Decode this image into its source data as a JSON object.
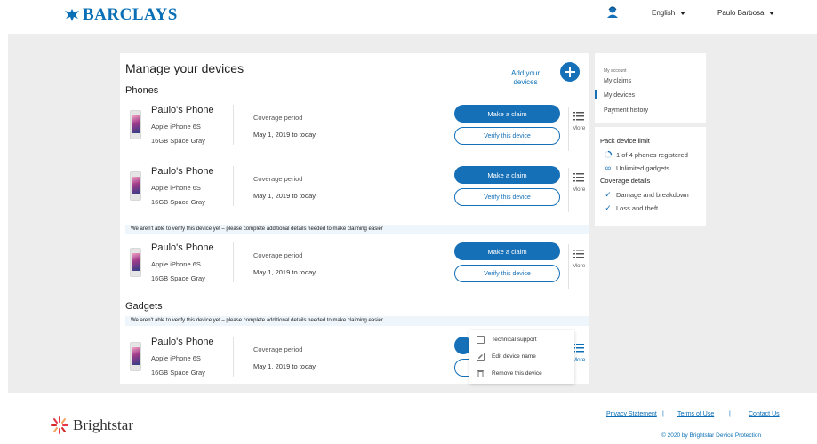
{
  "header": {
    "brand": "BARCLAYS",
    "language": "English",
    "user_name": "Paulo Barbosa"
  },
  "main": {
    "title": "Manage your devices",
    "add_label": "Add your devices",
    "phones_heading": "Phones",
    "gadgets_heading": "Gadgets",
    "warning": "We aren't able to verify this device yet – please complete additional details needed to make claiming easier",
    "devices": [
      {
        "name": "Paulo's Phone",
        "model": "Apple iPhone 6S",
        "spec": "16GB Space Gray",
        "coverage_label": "Coverage period",
        "coverage_dates": "May 1, 2019 to today",
        "claim_label": "Make a claim",
        "verify_label": "Verify this device",
        "more_label": "More"
      },
      {
        "name": "Paulo's Phone",
        "model": "Apple iPhone 6S",
        "spec": "16GB Space Gray",
        "coverage_label": "Coverage period",
        "coverage_dates": "May 1, 2019 to today",
        "claim_label": "Make a claim",
        "verify_label": "Verify this device",
        "more_label": "More"
      },
      {
        "name": "Paulo's Phone",
        "model": "Apple iPhone 6S",
        "spec": "16GB Space Gray",
        "coverage_label": "Coverage period",
        "coverage_dates": "May 1, 2019 to today",
        "claim_label": "Make a claim",
        "verify_label": "Verify this device",
        "more_label": "More"
      },
      {
        "name": "Paulo's Phone",
        "model": "Apple iPhone 6S",
        "spec": "16GB Space Gray",
        "coverage_label": "Coverage period",
        "coverage_dates": "May 1, 2019 to today",
        "claim_label": "",
        "verify_label": "",
        "more_label": "More"
      }
    ],
    "context_menu": [
      {
        "label": "Technical support",
        "icon": "support-icon"
      },
      {
        "label": "Edit device name",
        "icon": "edit-icon"
      },
      {
        "label": "Remove this device",
        "icon": "trash-icon"
      }
    ]
  },
  "sidebar": {
    "caption": "My account",
    "links": [
      "My claims",
      "My devices",
      "Payment history"
    ],
    "active_link": "My devices",
    "pack_heading": "Pack device limit",
    "pack_items": [
      {
        "label": "1 of 4 phones registered",
        "icon": "progress-ring-icon",
        "registered": 1,
        "limit": 4
      },
      {
        "label": "Unlimited gadgets",
        "icon": "infinity-icon"
      }
    ],
    "coverage_heading": "Coverage details",
    "coverage_items": [
      {
        "label": "Damage and breakdown",
        "icon": "check-icon"
      },
      {
        "label": "Loss and theft",
        "icon": "check-icon"
      }
    ]
  },
  "footer": {
    "brand": "Brightstar",
    "links": [
      "Privacy Statement",
      "Terms of Use",
      "Contact Us"
    ],
    "separator": "|",
    "copyright": "© 2020 by Brightstar Device Protection"
  },
  "colors": {
    "brand_blue": "#1570b8",
    "link_blue": "#0a6fb5",
    "canvas_gray": "#ededed",
    "warning_bg": "#eef5fb"
  }
}
